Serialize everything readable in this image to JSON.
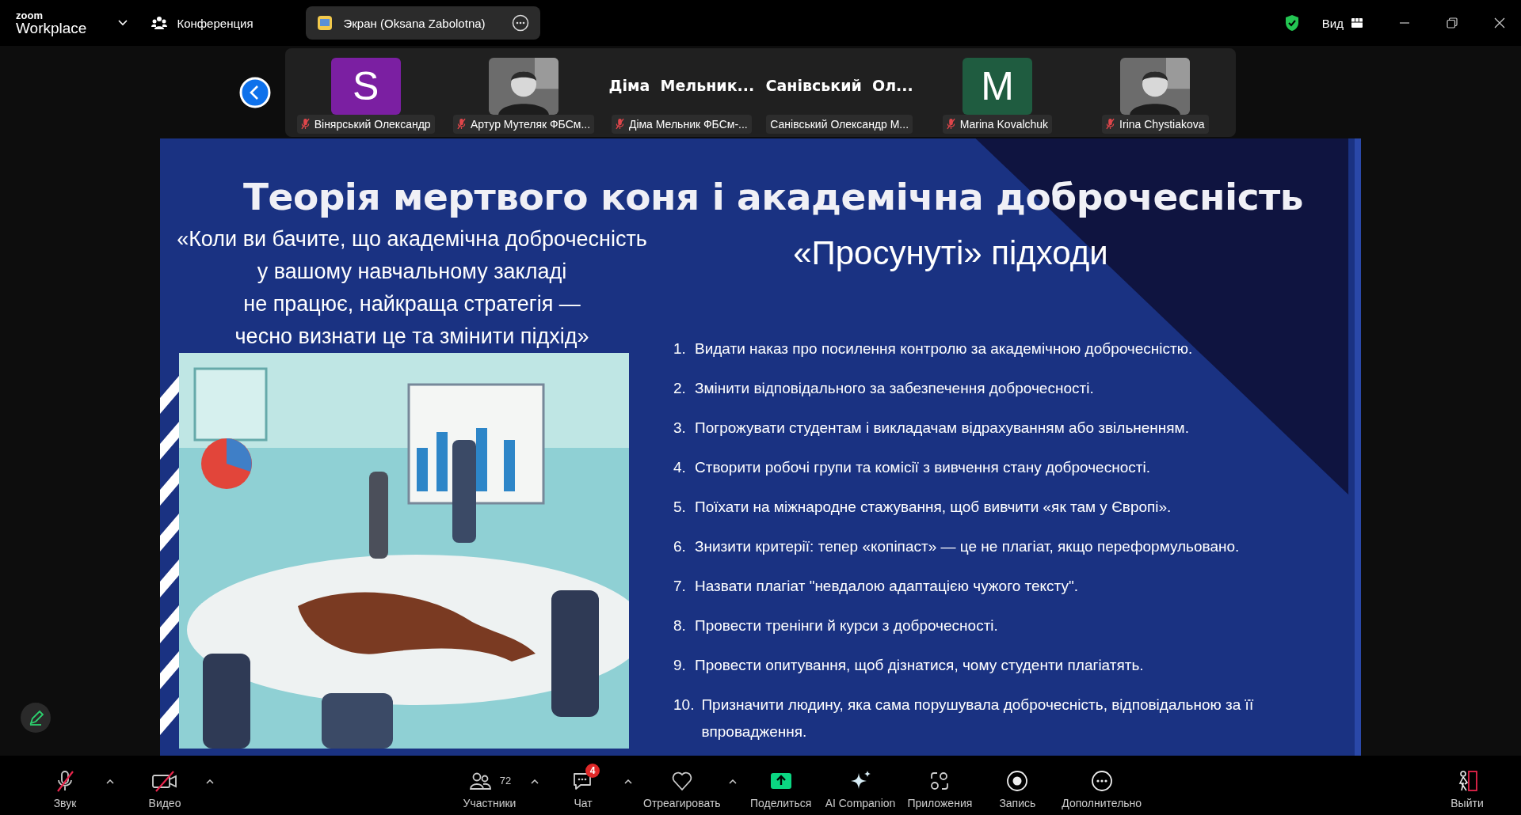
{
  "topbar": {
    "logo_small": "zoom",
    "logo": "Workplace",
    "meeting_label": "Конференция",
    "share_pill": "Экран (Oksana Zabolotna)",
    "view_label": "Вид"
  },
  "participants": [
    {
      "kind": "letter",
      "avatar_text": "S",
      "color": "#7b1fa2",
      "name": "Вінярський Олександр",
      "muted": true
    },
    {
      "name": "Артур Мутеляк ФБСм...",
      "muted": true
    },
    {
      "kind": "text",
      "display": "Діма  Мельник...",
      "name": "Діма Мельник ФБСм-...",
      "muted": true
    },
    {
      "kind": "text",
      "display": "Санівський  Ол...",
      "name": "Санівський Олександр М..."
    },
    {
      "kind": "letter",
      "avatar_text": "M",
      "color": "#1f5c40",
      "name": "Marina Kovalchuk",
      "muted": true
    },
    {
      "name": "Irina Chystiakova",
      "muted": true
    }
  ],
  "slide": {
    "title": "Теорія мертвого коня і академічна доброчесність",
    "quote_lines": [
      "«Коли ви бачите, що академічна доброчесність",
      "у вашому навчальному закладі",
      "не працює, найкраща стратегія —",
      "чесно визнати це та змінити підхід»"
    ],
    "heading": "«Просунуті» підходи",
    "items": [
      {
        "number": "1.",
        "text": "Видати наказ про посилення контролю за академічною доброчесністю."
      },
      {
        "number": "2.",
        "text": "Змінити відповідального за забезпечення доброчесності."
      },
      {
        "number": "3.",
        "text": "Погрожувати студентам і викладачам відрахуванням або звільненням."
      },
      {
        "number": "4.",
        "text": "Створити робочі групи та комісії з вивчення стану доброчесності."
      },
      {
        "number": "5.",
        "text": "Поїхати на міжнародне стажування, щоб вивчити «як там у Європі»."
      },
      {
        "number": "6.",
        "text": "Знизити критерії: тепер «копіпаст» — це не плагіат, якщо переформульовано."
      },
      {
        "number": "7.",
        "text": "Назвати плагіат \"невдалою адаптацією чужого тексту\"."
      },
      {
        "number": "8.",
        "text": "Провести тренінги й курси з доброчесності."
      },
      {
        "number": "9.",
        "text": "Провести опитування, щоб дізнатися, чому студенти плагіатять."
      },
      {
        "number": "10.",
        "text": "Призначити людину, яка сама порушувала доброчесність, відповідальною за її впровадження."
      }
    ]
  },
  "toolbar": {
    "left": [
      {
        "kind": "mic",
        "label": "Звук",
        "off": true,
        "menu": true
      },
      {
        "kind": "video",
        "label": "Видео",
        "off": true,
        "menu": true
      }
    ],
    "center": [
      {
        "kind": "participants",
        "label": "Участники",
        "count": "72",
        "menu": true
      },
      {
        "kind": "chat",
        "label": "Чат",
        "badge": "4",
        "menu": true
      },
      {
        "kind": "react",
        "label": "Отреагировать",
        "menu": true
      },
      {
        "kind": "share",
        "label": "Поделиться"
      },
      {
        "kind": "ai",
        "label": "AI Companion"
      },
      {
        "kind": "apps",
        "label": "Приложения"
      },
      {
        "kind": "record",
        "label": "Запись"
      },
      {
        "kind": "more",
        "label": "Дополнительно"
      }
    ],
    "right": [
      {
        "kind": "leave",
        "label": "Выйти"
      }
    ]
  }
}
